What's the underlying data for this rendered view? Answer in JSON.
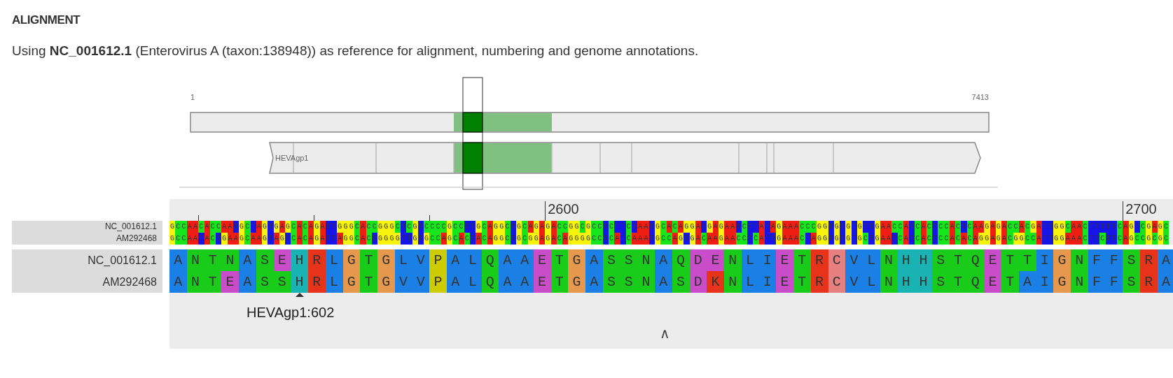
{
  "heading": "ALIGNMENT",
  "intro": "Using **NC_001612.1** (Enterovirus A (taxon:138948)) as reference for alignment, numbering and genome annotations.",
  "genome_map": {
    "start_label": "1",
    "end_label": "7413",
    "gene": {
      "name": "HEVAgp1"
    }
  },
  "alignment": {
    "ruler": [
      {
        "label": "2600"
      },
      {
        "label": "2700"
      }
    ],
    "nucleotide_rows": [
      {
        "name": "NC_001612.1",
        "bases": [
          {
            "base": "G",
            "color": "#f7f30e"
          },
          {
            "base": "C",
            "color": "#17e51b"
          },
          {
            "base": "C",
            "color": "#17e51b"
          },
          {
            "base": "A",
            "color": "#f01e12"
          },
          {
            "base": "A",
            "color": "#f01e12"
          },
          {
            "base": "C",
            "color": "#17e51b"
          },
          {
            "base": "A",
            "color": "#f01e12"
          },
          {
            "base": "C",
            "color": "#17e51b"
          },
          {
            "base": "C",
            "color": "#17e51b"
          },
          {
            "base": "A",
            "color": "#f01e12"
          },
          {
            "base": "A",
            "color": "#f01e12"
          },
          {
            "base": "T",
            "color": "#1515e8"
          },
          {
            "base": "G",
            "color": "#f7f30e"
          },
          {
            "base": "C",
            "color": "#17e51b"
          },
          {
            "base": "T",
            "color": "#1515e8"
          },
          {
            "base": "A",
            "color": "#f01e12"
          },
          {
            "base": "G",
            "color": "#f7f30e"
          },
          {
            "base": "T",
            "color": "#1515e8"
          },
          {
            "base": "G",
            "color": "#f7f30e"
          },
          {
            "base": "A",
            "color": "#f01e12"
          },
          {
            "base": "G",
            "color": "#f7f30e"
          },
          {
            "base": "C",
            "color": "#17e51b"
          },
          {
            "base": "A",
            "color": "#f01e12"
          },
          {
            "base": "C",
            "color": "#17e51b"
          },
          {
            "base": "A",
            "color": "#f01e12"
          },
          {
            "base": "G",
            "color": "#f7f30e"
          },
          {
            "base": "A",
            "color": "#f01e12"
          },
          {
            "base": "T",
            "color": "#1515e8"
          },
          {
            "base": "T",
            "color": "#1515e8"
          },
          {
            "base": "G",
            "color": "#f7f30e"
          },
          {
            "base": "G",
            "color": "#f7f30e"
          },
          {
            "base": "G",
            "color": "#f7f30e"
          },
          {
            "base": "C",
            "color": "#17e51b"
          },
          {
            "base": "A",
            "color": "#f01e12"
          },
          {
            "base": "C",
            "color": "#17e51b"
          },
          {
            "base": "C",
            "color": "#17e51b"
          },
          {
            "base": "G",
            "color": "#f7f30e"
          },
          {
            "base": "G",
            "color": "#f7f30e"
          },
          {
            "base": "G",
            "color": "#f7f30e"
          },
          {
            "base": "C",
            "color": "#17e51b"
          },
          {
            "base": "T",
            "color": "#1515e8"
          },
          {
            "base": "C",
            "color": "#17e51b"
          },
          {
            "base": "G",
            "color": "#f7f30e"
          },
          {
            "base": "T",
            "color": "#1515e8"
          },
          {
            "base": "C",
            "color": "#17e51b"
          },
          {
            "base": "C",
            "color": "#17e51b"
          },
          {
            "base": "C",
            "color": "#17e51b"
          },
          {
            "base": "C",
            "color": "#17e51b"
          },
          {
            "base": "G",
            "color": "#f7f30e"
          },
          {
            "base": "C",
            "color": "#17e51b"
          },
          {
            "base": "C",
            "color": "#17e51b"
          },
          {
            "base": "T",
            "color": "#1515e8"
          },
          {
            "base": "T",
            "color": "#1515e8"
          },
          {
            "base": "G",
            "color": "#f7f30e"
          },
          {
            "base": "C",
            "color": "#17e51b"
          },
          {
            "base": "A",
            "color": "#f01e12"
          },
          {
            "base": "G",
            "color": "#f7f30e"
          },
          {
            "base": "G",
            "color": "#f7f30e"
          },
          {
            "base": "C",
            "color": "#17e51b"
          },
          {
            "base": "T",
            "color": "#1515e8"
          },
          {
            "base": "G",
            "color": "#f7f30e"
          },
          {
            "base": "C",
            "color": "#17e51b"
          },
          {
            "base": "A",
            "color": "#f01e12"
          },
          {
            "base": "G",
            "color": "#f7f30e"
          },
          {
            "base": "A",
            "color": "#f01e12"
          },
          {
            "base": "G",
            "color": "#f7f30e"
          },
          {
            "base": "A",
            "color": "#f01e12"
          },
          {
            "base": "C",
            "color": "#17e51b"
          },
          {
            "base": "C",
            "color": "#17e51b"
          },
          {
            "base": "G",
            "color": "#f7f30e"
          },
          {
            "base": "G",
            "color": "#f7f30e"
          },
          {
            "base": "C",
            "color": "#17e51b"
          },
          {
            "base": "G",
            "color": "#f7f30e"
          },
          {
            "base": "C",
            "color": "#17e51b"
          },
          {
            "base": "C",
            "color": "#17e51b"
          },
          {
            "base": "T",
            "color": "#1515e8"
          },
          {
            "base": "C",
            "color": "#17e51b"
          },
          {
            "base": "T",
            "color": "#1515e8"
          },
          {
            "base": "T",
            "color": "#1515e8"
          },
          {
            "base": "C",
            "color": "#17e51b"
          },
          {
            "base": "T",
            "color": "#1515e8"
          },
          {
            "base": "A",
            "color": "#f01e12"
          },
          {
            "base": "A",
            "color": "#f01e12"
          },
          {
            "base": "T",
            "color": "#1515e8"
          },
          {
            "base": "G",
            "color": "#f7f30e"
          },
          {
            "base": "C",
            "color": "#17e51b"
          },
          {
            "base": "A",
            "color": "#f01e12"
          },
          {
            "base": "C",
            "color": "#17e51b"
          },
          {
            "base": "A",
            "color": "#f01e12"
          },
          {
            "base": "G",
            "color": "#f7f30e"
          },
          {
            "base": "G",
            "color": "#f7f30e"
          },
          {
            "base": "A",
            "color": "#f01e12"
          },
          {
            "base": "T",
            "color": "#1515e8"
          },
          {
            "base": "G",
            "color": "#f7f30e"
          },
          {
            "base": "A",
            "color": "#f01e12"
          },
          {
            "base": "G",
            "color": "#f7f30e"
          },
          {
            "base": "A",
            "color": "#f01e12"
          },
          {
            "base": "A",
            "color": "#f01e12"
          },
          {
            "base": "T",
            "color": "#1515e8"
          },
          {
            "base": "C",
            "color": "#17e51b"
          },
          {
            "base": "T",
            "color": "#1515e8"
          },
          {
            "base": "T",
            "color": "#1515e8"
          },
          {
            "base": "A",
            "color": "#f01e12"
          },
          {
            "base": "T",
            "color": "#1515e8"
          },
          {
            "base": "A",
            "color": "#f01e12"
          },
          {
            "base": "G",
            "color": "#f7f30e"
          },
          {
            "base": "A",
            "color": "#f01e12"
          },
          {
            "base": "A",
            "color": "#f01e12"
          },
          {
            "base": "A",
            "color": "#f01e12"
          },
          {
            "base": "C",
            "color": "#17e51b"
          },
          {
            "base": "C",
            "color": "#17e51b"
          },
          {
            "base": "C",
            "color": "#17e51b"
          },
          {
            "base": "G",
            "color": "#f7f30e"
          },
          {
            "base": "G",
            "color": "#f7f30e"
          },
          {
            "base": "T",
            "color": "#1515e8"
          },
          {
            "base": "G",
            "color": "#f7f30e"
          },
          {
            "base": "T",
            "color": "#1515e8"
          },
          {
            "base": "G",
            "color": "#f7f30e"
          },
          {
            "base": "T",
            "color": "#1515e8"
          },
          {
            "base": "G",
            "color": "#f7f30e"
          },
          {
            "base": "T",
            "color": "#1515e8"
          },
          {
            "base": "T",
            "color": "#1515e8"
          },
          {
            "base": "G",
            "color": "#f7f30e"
          },
          {
            "base": "A",
            "color": "#f01e12"
          },
          {
            "base": "A",
            "color": "#f01e12"
          },
          {
            "base": "C",
            "color": "#17e51b"
          },
          {
            "base": "C",
            "color": "#17e51b"
          },
          {
            "base": "A",
            "color": "#f01e12"
          },
          {
            "base": "T",
            "color": "#1515e8"
          },
          {
            "base": "C",
            "color": "#17e51b"
          },
          {
            "base": "A",
            "color": "#f01e12"
          },
          {
            "base": "C",
            "color": "#17e51b"
          },
          {
            "base": "T",
            "color": "#1515e8"
          },
          {
            "base": "C",
            "color": "#17e51b"
          },
          {
            "base": "C",
            "color": "#17e51b"
          },
          {
            "base": "A",
            "color": "#f01e12"
          },
          {
            "base": "C",
            "color": "#17e51b"
          },
          {
            "base": "T",
            "color": "#1515e8"
          },
          {
            "base": "C",
            "color": "#17e51b"
          },
          {
            "base": "A",
            "color": "#f01e12"
          },
          {
            "base": "A",
            "color": "#f01e12"
          },
          {
            "base": "G",
            "color": "#f7f30e"
          },
          {
            "base": "A",
            "color": "#f01e12"
          },
          {
            "base": "G",
            "color": "#f7f30e"
          },
          {
            "base": "A",
            "color": "#f01e12"
          },
          {
            "base": "C",
            "color": "#17e51b"
          },
          {
            "base": "C",
            "color": "#17e51b"
          },
          {
            "base": "A",
            "color": "#f01e12"
          },
          {
            "base": "C",
            "color": "#17e51b"
          },
          {
            "base": "G",
            "color": "#f7f30e"
          },
          {
            "base": "A",
            "color": "#f01e12"
          },
          {
            "base": "T",
            "color": "#1515e8"
          },
          {
            "base": "T",
            "color": "#1515e8"
          },
          {
            "base": "G",
            "color": "#f7f30e"
          },
          {
            "base": "G",
            "color": "#f7f30e"
          },
          {
            "base": "C",
            "color": "#17e51b"
          },
          {
            "base": "A",
            "color": "#f01e12"
          },
          {
            "base": "A",
            "color": "#f01e12"
          },
          {
            "base": "C",
            "color": "#17e51b"
          },
          {
            "base": "T",
            "color": "#1515e8"
          },
          {
            "base": "T",
            "color": "#1515e8"
          },
          {
            "base": "T",
            "color": "#1515e8"
          },
          {
            "base": "T",
            "color": "#1515e8"
          },
          {
            "base": "T",
            "color": "#1515e8"
          },
          {
            "base": "C",
            "color": "#17e51b"
          },
          {
            "base": "A",
            "color": "#f01e12"
          },
          {
            "base": "G",
            "color": "#f7f30e"
          },
          {
            "base": "T",
            "color": "#1515e8"
          },
          {
            "base": "C",
            "color": "#17e51b"
          },
          {
            "base": "G",
            "color": "#f7f30e"
          },
          {
            "base": "A",
            "color": "#f01e12"
          },
          {
            "base": "G",
            "color": "#f7f30e"
          },
          {
            "base": "C",
            "color": "#17e51b"
          }
        ]
      },
      {
        "name": "AM292468",
        "bases": [
          {
            "base": "G",
            "color": "#f7f30e"
          },
          {
            "base": "C",
            "color": "#17e51b"
          },
          {
            "base": "C",
            "color": "#17e51b"
          },
          {
            "base": "A",
            "color": "#f01e12"
          },
          {
            "base": "A",
            "color": "#f01e12"
          },
          {
            "base": "T",
            "color": "#1515e8"
          },
          {
            "base": "A",
            "color": "#f01e12"
          },
          {
            "base": "C",
            "color": "#17e51b"
          },
          {
            "base": "T",
            "color": "#1515e8"
          },
          {
            "base": "G",
            "color": "#f7f30e"
          },
          {
            "base": "A",
            "color": "#f01e12"
          },
          {
            "base": "A",
            "color": "#f01e12"
          },
          {
            "base": "G",
            "color": "#f7f30e"
          },
          {
            "base": "C",
            "color": "#17e51b"
          },
          {
            "base": "A",
            "color": "#f01e12"
          },
          {
            "base": "A",
            "color": "#f01e12"
          },
          {
            "base": "G",
            "color": "#f7f30e"
          },
          {
            "base": "T",
            "color": "#1515e8"
          },
          {
            "base": "A",
            "color": "#f01e12"
          },
          {
            "base": "G",
            "color": "#f7f30e"
          },
          {
            "base": "T",
            "color": "#1515e8"
          },
          {
            "base": "C",
            "color": "#17e51b"
          },
          {
            "base": "A",
            "color": "#f01e12"
          },
          {
            "base": "C",
            "color": "#17e51b"
          },
          {
            "base": "A",
            "color": "#f01e12"
          },
          {
            "base": "G",
            "color": "#f7f30e"
          },
          {
            "base": "A",
            "color": "#f01e12"
          },
          {
            "base": "T",
            "color": "#1515e8"
          },
          {
            "base": "T",
            "color": "#1515e8"
          },
          {
            "base": "A",
            "color": "#f01e12"
          },
          {
            "base": "G",
            "color": "#f7f30e"
          },
          {
            "base": "G",
            "color": "#f7f30e"
          },
          {
            "base": "C",
            "color": "#17e51b"
          },
          {
            "base": "A",
            "color": "#f01e12"
          },
          {
            "base": "C",
            "color": "#17e51b"
          },
          {
            "base": "T",
            "color": "#1515e8"
          },
          {
            "base": "G",
            "color": "#f7f30e"
          },
          {
            "base": "G",
            "color": "#f7f30e"
          },
          {
            "base": "G",
            "color": "#f7f30e"
          },
          {
            "base": "G",
            "color": "#f7f30e"
          },
          {
            "base": "T",
            "color": "#1515e8"
          },
          {
            "base": "T",
            "color": "#1515e8"
          },
          {
            "base": "G",
            "color": "#f7f30e"
          },
          {
            "base": "T",
            "color": "#1515e8"
          },
          {
            "base": "G",
            "color": "#f7f30e"
          },
          {
            "base": "C",
            "color": "#17e51b"
          },
          {
            "base": "C",
            "color": "#17e51b"
          },
          {
            "base": "A",
            "color": "#f01e12"
          },
          {
            "base": "G",
            "color": "#f7f30e"
          },
          {
            "base": "C",
            "color": "#17e51b"
          },
          {
            "base": "A",
            "color": "#f01e12"
          },
          {
            "base": "C",
            "color": "#17e51b"
          },
          {
            "base": "T",
            "color": "#1515e8"
          },
          {
            "base": "A",
            "color": "#f01e12"
          },
          {
            "base": "C",
            "color": "#17e51b"
          },
          {
            "base": "A",
            "color": "#f01e12"
          },
          {
            "base": "G",
            "color": "#f7f30e"
          },
          {
            "base": "G",
            "color": "#f7f30e"
          },
          {
            "base": "C",
            "color": "#17e51b"
          },
          {
            "base": "T",
            "color": "#1515e8"
          },
          {
            "base": "G",
            "color": "#f7f30e"
          },
          {
            "base": "C",
            "color": "#17e51b"
          },
          {
            "base": "G",
            "color": "#f7f30e"
          },
          {
            "base": "G",
            "color": "#f7f30e"
          },
          {
            "base": "A",
            "color": "#f01e12"
          },
          {
            "base": "G",
            "color": "#f7f30e"
          },
          {
            "base": "A",
            "color": "#f01e12"
          },
          {
            "base": "C",
            "color": "#17e51b"
          },
          {
            "base": "A",
            "color": "#f01e12"
          },
          {
            "base": "G",
            "color": "#f7f30e"
          },
          {
            "base": "G",
            "color": "#f7f30e"
          },
          {
            "base": "G",
            "color": "#f7f30e"
          },
          {
            "base": "G",
            "color": "#f7f30e"
          },
          {
            "base": "C",
            "color": "#17e51b"
          },
          {
            "base": "C",
            "color": "#17e51b"
          },
          {
            "base": "T",
            "color": "#1515e8"
          },
          {
            "base": "C",
            "color": "#17e51b"
          },
          {
            "base": "A",
            "color": "#f01e12"
          },
          {
            "base": "T",
            "color": "#1515e8"
          },
          {
            "base": "C",
            "color": "#17e51b"
          },
          {
            "base": "A",
            "color": "#f01e12"
          },
          {
            "base": "A",
            "color": "#f01e12"
          },
          {
            "base": "A",
            "color": "#f01e12"
          },
          {
            "base": "T",
            "color": "#1515e8"
          },
          {
            "base": "G",
            "color": "#f7f30e"
          },
          {
            "base": "C",
            "color": "#17e51b"
          },
          {
            "base": "C",
            "color": "#17e51b"
          },
          {
            "base": "A",
            "color": "#f01e12"
          },
          {
            "base": "G",
            "color": "#f7f30e"
          },
          {
            "base": "T",
            "color": "#1515e8"
          },
          {
            "base": "G",
            "color": "#f7f30e"
          },
          {
            "base": "A",
            "color": "#f01e12"
          },
          {
            "base": "C",
            "color": "#17e51b"
          },
          {
            "base": "A",
            "color": "#f01e12"
          },
          {
            "base": "A",
            "color": "#f01e12"
          },
          {
            "base": "G",
            "color": "#f7f30e"
          },
          {
            "base": "A",
            "color": "#f01e12"
          },
          {
            "base": "A",
            "color": "#f01e12"
          },
          {
            "base": "C",
            "color": "#17e51b"
          },
          {
            "base": "C",
            "color": "#17e51b"
          },
          {
            "base": "T",
            "color": "#1515e8"
          },
          {
            "base": "C",
            "color": "#17e51b"
          },
          {
            "base": "A",
            "color": "#f01e12"
          },
          {
            "base": "T",
            "color": "#1515e8"
          },
          {
            "base": "T",
            "color": "#1515e8"
          },
          {
            "base": "G",
            "color": "#f7f30e"
          },
          {
            "base": "A",
            "color": "#f01e12"
          },
          {
            "base": "A",
            "color": "#f01e12"
          },
          {
            "base": "A",
            "color": "#f01e12"
          },
          {
            "base": "C",
            "color": "#17e51b"
          },
          {
            "base": "T",
            "color": "#1515e8"
          },
          {
            "base": "A",
            "color": "#f01e12"
          },
          {
            "base": "G",
            "color": "#f7f30e"
          },
          {
            "base": "G",
            "color": "#f7f30e"
          },
          {
            "base": "T",
            "color": "#1515e8"
          },
          {
            "base": "G",
            "color": "#f7f30e"
          },
          {
            "base": "T",
            "color": "#1515e8"
          },
          {
            "base": "G",
            "color": "#f7f30e"
          },
          {
            "base": "T",
            "color": "#1515e8"
          },
          {
            "base": "G",
            "color": "#f7f30e"
          },
          {
            "base": "C",
            "color": "#17e51b"
          },
          {
            "base": "T",
            "color": "#1515e8"
          },
          {
            "base": "G",
            "color": "#f7f30e"
          },
          {
            "base": "A",
            "color": "#f01e12"
          },
          {
            "base": "A",
            "color": "#f01e12"
          },
          {
            "base": "T",
            "color": "#1515e8"
          },
          {
            "base": "C",
            "color": "#17e51b"
          },
          {
            "base": "A",
            "color": "#f01e12"
          },
          {
            "base": "T",
            "color": "#1515e8"
          },
          {
            "base": "C",
            "color": "#17e51b"
          },
          {
            "base": "A",
            "color": "#f01e12"
          },
          {
            "base": "C",
            "color": "#17e51b"
          },
          {
            "base": "T",
            "color": "#1515e8"
          },
          {
            "base": "C",
            "color": "#17e51b"
          },
          {
            "base": "C",
            "color": "#17e51b"
          },
          {
            "base": "A",
            "color": "#f01e12"
          },
          {
            "base": "C",
            "color": "#17e51b"
          },
          {
            "base": "A",
            "color": "#f01e12"
          },
          {
            "base": "C",
            "color": "#17e51b"
          },
          {
            "base": "A",
            "color": "#f01e12"
          },
          {
            "base": "G",
            "color": "#f7f30e"
          },
          {
            "base": "G",
            "color": "#f7f30e"
          },
          {
            "base": "A",
            "color": "#f01e12"
          },
          {
            "base": "G",
            "color": "#f7f30e"
          },
          {
            "base": "A",
            "color": "#f01e12"
          },
          {
            "base": "C",
            "color": "#17e51b"
          },
          {
            "base": "G",
            "color": "#f7f30e"
          },
          {
            "base": "G",
            "color": "#f7f30e"
          },
          {
            "base": "C",
            "color": "#17e51b"
          },
          {
            "base": "C",
            "color": "#17e51b"
          },
          {
            "base": "A",
            "color": "#f01e12"
          },
          {
            "base": "T",
            "color": "#1515e8"
          },
          {
            "base": "T",
            "color": "#1515e8"
          },
          {
            "base": "G",
            "color": "#f7f30e"
          },
          {
            "base": "G",
            "color": "#f7f30e"
          },
          {
            "base": "A",
            "color": "#f01e12"
          },
          {
            "base": "A",
            "color": "#f01e12"
          },
          {
            "base": "A",
            "color": "#f01e12"
          },
          {
            "base": "C",
            "color": "#17e51b"
          },
          {
            "base": "T",
            "color": "#1515e8"
          },
          {
            "base": "T",
            "color": "#1515e8"
          },
          {
            "base": "C",
            "color": "#17e51b"
          },
          {
            "base": "T",
            "color": "#1515e8"
          },
          {
            "base": "T",
            "color": "#1515e8"
          },
          {
            "base": "C",
            "color": "#17e51b"
          },
          {
            "base": "A",
            "color": "#f01e12"
          },
          {
            "base": "G",
            "color": "#f7f30e"
          },
          {
            "base": "C",
            "color": "#17e51b"
          },
          {
            "base": "C",
            "color": "#17e51b"
          },
          {
            "base": "G",
            "color": "#f7f30e"
          },
          {
            "base": "C",
            "color": "#17e51b"
          },
          {
            "base": "G",
            "color": "#f7f30e"
          },
          {
            "base": "C",
            "color": "#17e51b"
          }
        ]
      }
    ],
    "protein_rows": [
      {
        "name": "NC_001612.1",
        "residues": [
          {
            "residue": "A",
            "color": "#1a80e6"
          },
          {
            "residue": "N",
            "color": "#19cc19"
          },
          {
            "residue": "T",
            "color": "#19cc19"
          },
          {
            "residue": "N",
            "color": "#19cc19"
          },
          {
            "residue": "A",
            "color": "#1a80e6"
          },
          {
            "residue": "S",
            "color": "#19cc19"
          },
          {
            "residue": "E",
            "color": "#c94dc9"
          },
          {
            "residue": "H",
            "color": "#19b3b3"
          },
          {
            "residue": "R",
            "color": "#e6331a"
          },
          {
            "residue": "L",
            "color": "#1a80e6"
          },
          {
            "residue": "G",
            "color": "#e6994d"
          },
          {
            "residue": "T",
            "color": "#19cc19"
          },
          {
            "residue": "G",
            "color": "#e6994d"
          },
          {
            "residue": "L",
            "color": "#1a80e6"
          },
          {
            "residue": "V",
            "color": "#1a80e6"
          },
          {
            "residue": "P",
            "color": "#cccc00"
          },
          {
            "residue": "A",
            "color": "#1a80e6"
          },
          {
            "residue": "L",
            "color": "#1a80e6"
          },
          {
            "residue": "Q",
            "color": "#19cc19"
          },
          {
            "residue": "A",
            "color": "#1a80e6"
          },
          {
            "residue": "A",
            "color": "#1a80e6"
          },
          {
            "residue": "E",
            "color": "#c94dc9"
          },
          {
            "residue": "T",
            "color": "#19cc19"
          },
          {
            "residue": "G",
            "color": "#e6994d"
          },
          {
            "residue": "A",
            "color": "#1a80e6"
          },
          {
            "residue": "S",
            "color": "#19cc19"
          },
          {
            "residue": "S",
            "color": "#19cc19"
          },
          {
            "residue": "N",
            "color": "#19cc19"
          },
          {
            "residue": "A",
            "color": "#1a80e6"
          },
          {
            "residue": "Q",
            "color": "#19cc19"
          },
          {
            "residue": "D",
            "color": "#c94dc9"
          },
          {
            "residue": "E",
            "color": "#c94dc9"
          },
          {
            "residue": "N",
            "color": "#19cc19"
          },
          {
            "residue": "L",
            "color": "#1a80e6"
          },
          {
            "residue": "I",
            "color": "#1a80e6"
          },
          {
            "residue": "E",
            "color": "#c94dc9"
          },
          {
            "residue": "T",
            "color": "#19cc19"
          },
          {
            "residue": "R",
            "color": "#e6331a"
          },
          {
            "residue": "C",
            "color": "#e68080"
          },
          {
            "residue": "V",
            "color": "#1a80e6"
          },
          {
            "residue": "L",
            "color": "#1a80e6"
          },
          {
            "residue": "N",
            "color": "#19cc19"
          },
          {
            "residue": "H",
            "color": "#19b3b3"
          },
          {
            "residue": "H",
            "color": "#19b3b3"
          },
          {
            "residue": "S",
            "color": "#19cc19"
          },
          {
            "residue": "T",
            "color": "#19cc19"
          },
          {
            "residue": "Q",
            "color": "#19cc19"
          },
          {
            "residue": "E",
            "color": "#c94dc9"
          },
          {
            "residue": "T",
            "color": "#19cc19"
          },
          {
            "residue": "T",
            "color": "#19cc19"
          },
          {
            "residue": "I",
            "color": "#1a80e6"
          },
          {
            "residue": "G",
            "color": "#e6994d"
          },
          {
            "residue": "N",
            "color": "#19cc19"
          },
          {
            "residue": "F",
            "color": "#1a80e6"
          },
          {
            "residue": "F",
            "color": "#1a80e6"
          },
          {
            "residue": "S",
            "color": "#19cc19"
          },
          {
            "residue": "R",
            "color": "#e6331a"
          },
          {
            "residue": "A",
            "color": "#1a80e6"
          }
        ]
      },
      {
        "name": "AM292468",
        "residues": [
          {
            "residue": "A",
            "color": "#1a80e6"
          },
          {
            "residue": "N",
            "color": "#19cc19"
          },
          {
            "residue": "T",
            "color": "#19cc19"
          },
          {
            "residue": "E",
            "color": "#c94dc9"
          },
          {
            "residue": "A",
            "color": "#1a80e6"
          },
          {
            "residue": "S",
            "color": "#19cc19"
          },
          {
            "residue": "S",
            "color": "#19cc19"
          },
          {
            "residue": "H",
            "color": "#19b3b3"
          },
          {
            "residue": "R",
            "color": "#e6331a"
          },
          {
            "residue": "L",
            "color": "#1a80e6"
          },
          {
            "residue": "G",
            "color": "#e6994d"
          },
          {
            "residue": "T",
            "color": "#19cc19"
          },
          {
            "residue": "G",
            "color": "#e6994d"
          },
          {
            "residue": "V",
            "color": "#1a80e6"
          },
          {
            "residue": "V",
            "color": "#1a80e6"
          },
          {
            "residue": "P",
            "color": "#cccc00"
          },
          {
            "residue": "A",
            "color": "#1a80e6"
          },
          {
            "residue": "L",
            "color": "#1a80e6"
          },
          {
            "residue": "Q",
            "color": "#19cc19"
          },
          {
            "residue": "A",
            "color": "#1a80e6"
          },
          {
            "residue": "A",
            "color": "#1a80e6"
          },
          {
            "residue": "E",
            "color": "#c94dc9"
          },
          {
            "residue": "T",
            "color": "#19cc19"
          },
          {
            "residue": "G",
            "color": "#e6994d"
          },
          {
            "residue": "A",
            "color": "#1a80e6"
          },
          {
            "residue": "S",
            "color": "#19cc19"
          },
          {
            "residue": "S",
            "color": "#19cc19"
          },
          {
            "residue": "N",
            "color": "#19cc19"
          },
          {
            "residue": "A",
            "color": "#1a80e6"
          },
          {
            "residue": "S",
            "color": "#19cc19"
          },
          {
            "residue": "D",
            "color": "#c94dc9"
          },
          {
            "residue": "K",
            "color": "#e6331a"
          },
          {
            "residue": "N",
            "color": "#19cc19"
          },
          {
            "residue": "L",
            "color": "#1a80e6"
          },
          {
            "residue": "I",
            "color": "#1a80e6"
          },
          {
            "residue": "E",
            "color": "#c94dc9"
          },
          {
            "residue": "T",
            "color": "#19cc19"
          },
          {
            "residue": "R",
            "color": "#e6331a"
          },
          {
            "residue": "C",
            "color": "#e68080"
          },
          {
            "residue": "V",
            "color": "#1a80e6"
          },
          {
            "residue": "L",
            "color": "#1a80e6"
          },
          {
            "residue": "N",
            "color": "#19cc19"
          },
          {
            "residue": "H",
            "color": "#19b3b3"
          },
          {
            "residue": "H",
            "color": "#19b3b3"
          },
          {
            "residue": "S",
            "color": "#19cc19"
          },
          {
            "residue": "T",
            "color": "#19cc19"
          },
          {
            "residue": "Q",
            "color": "#19cc19"
          },
          {
            "residue": "E",
            "color": "#c94dc9"
          },
          {
            "residue": "T",
            "color": "#19cc19"
          },
          {
            "residue": "A",
            "color": "#1a80e6"
          },
          {
            "residue": "I",
            "color": "#1a80e6"
          },
          {
            "residue": "G",
            "color": "#e6994d"
          },
          {
            "residue": "N",
            "color": "#19cc19"
          },
          {
            "residue": "F",
            "color": "#1a80e6"
          },
          {
            "residue": "F",
            "color": "#1a80e6"
          },
          {
            "residue": "S",
            "color": "#19cc19"
          },
          {
            "residue": "R",
            "color": "#e6331a"
          },
          {
            "residue": "A",
            "color": "#1a80e6"
          }
        ]
      }
    ],
    "marker": {
      "label": "HEVAgp1:602"
    },
    "expand": "∧"
  }
}
